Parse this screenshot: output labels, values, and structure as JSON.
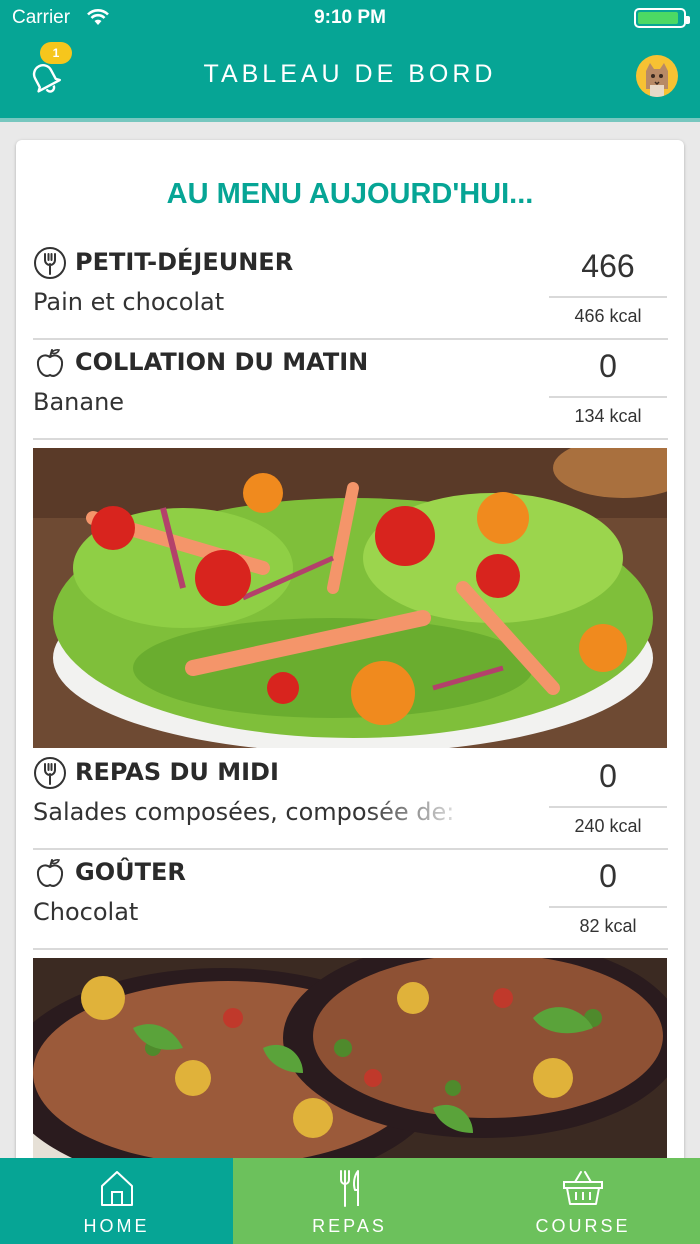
{
  "status_bar": {
    "carrier": "Carrier",
    "time": "9:10 PM"
  },
  "header": {
    "title": "TABLEAU DE BORD",
    "notification_count": "1"
  },
  "menu": {
    "title": "AU MENU AUJOURD'HUI...",
    "meals": [
      {
        "name": "PETIT-DÉJEUNER",
        "description": "Pain et chocolat",
        "value": "466",
        "kcal": "466 kcal",
        "icon": "fork-icon"
      },
      {
        "name": "COLLATION DU MATIN",
        "description": "Banane",
        "value": "0",
        "kcal": "134 kcal",
        "icon": "apple-icon"
      },
      {
        "name": "REPAS DU MIDI",
        "description": "Salades composées, composée de:",
        "value": "0",
        "kcal": "240 kcal",
        "icon": "fork-icon"
      },
      {
        "name": "GOÛTER",
        "description": "Chocolat",
        "value": "0",
        "kcal": "82 kcal",
        "icon": "apple-icon"
      }
    ]
  },
  "tabs": [
    {
      "label": "HOME",
      "icon": "home-icon",
      "active": true
    },
    {
      "label": "REPAS",
      "icon": "utensils-icon",
      "active": false
    },
    {
      "label": "COURSE",
      "icon": "basket-icon",
      "active": false
    }
  ],
  "colors": {
    "primary": "#06a595",
    "tab_green": "#6cc15c",
    "badge": "#f6c61c"
  }
}
